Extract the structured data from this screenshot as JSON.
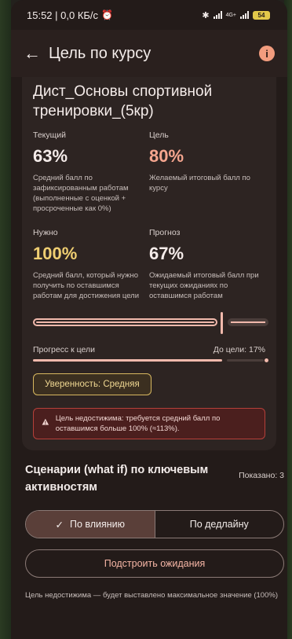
{
  "status": {
    "time_info": "15:52 | 0,0 КБ/с",
    "net_label": "4G+",
    "battery": "54"
  },
  "appbar": {
    "title": "Цель по курсу",
    "info_symbol": "i"
  },
  "card": {
    "course_title": "Дист_Основы спортивной тренировки_(5кр)",
    "current": {
      "label": "Текущий",
      "value": "63%",
      "desc": "Средний балл по зафиксированным работам (выполненные с оценкой + просроченные как 0%)"
    },
    "goal": {
      "label": "Цель",
      "value": "80%",
      "desc": "Желаемый итоговый балл по курсу"
    },
    "need": {
      "label": "Нужно",
      "value": "100%",
      "desc": "Средний балл, который нужно получить по оставшимся работам для достижения цели"
    },
    "forecast": {
      "label": "Прогноз",
      "value": "67%",
      "desc": "Ожидаемый итоговый балл при текущих ожиданиях по оставшимся работам"
    },
    "slider_value_fraction": 0.8,
    "progress": {
      "label": "Прогресс к цели",
      "remaining_label": "До цели: 17%",
      "fraction": 0.83
    },
    "confidence_chip": "Уверенность: Средняя",
    "alert_text": "Цель недостижима: требуется средний балл по оставшимся больше 100% (≈113%)."
  },
  "scenarios": {
    "title": "Сценарии (what if) по ключевым активностям",
    "shown": "Показано: 3",
    "tab_impact": "По влиянию",
    "tab_deadline": "По дедлайну",
    "adjust_button": "Подстроить ожидания",
    "footer_note": "Цель недостижима — будет выставлено максимальное значение (100%)"
  },
  "colors": {
    "accent": "#f1b9ac",
    "goal_value": "#f6a68f",
    "need_value": "#f0cf72",
    "alert_bg": "#4b1f1e"
  }
}
